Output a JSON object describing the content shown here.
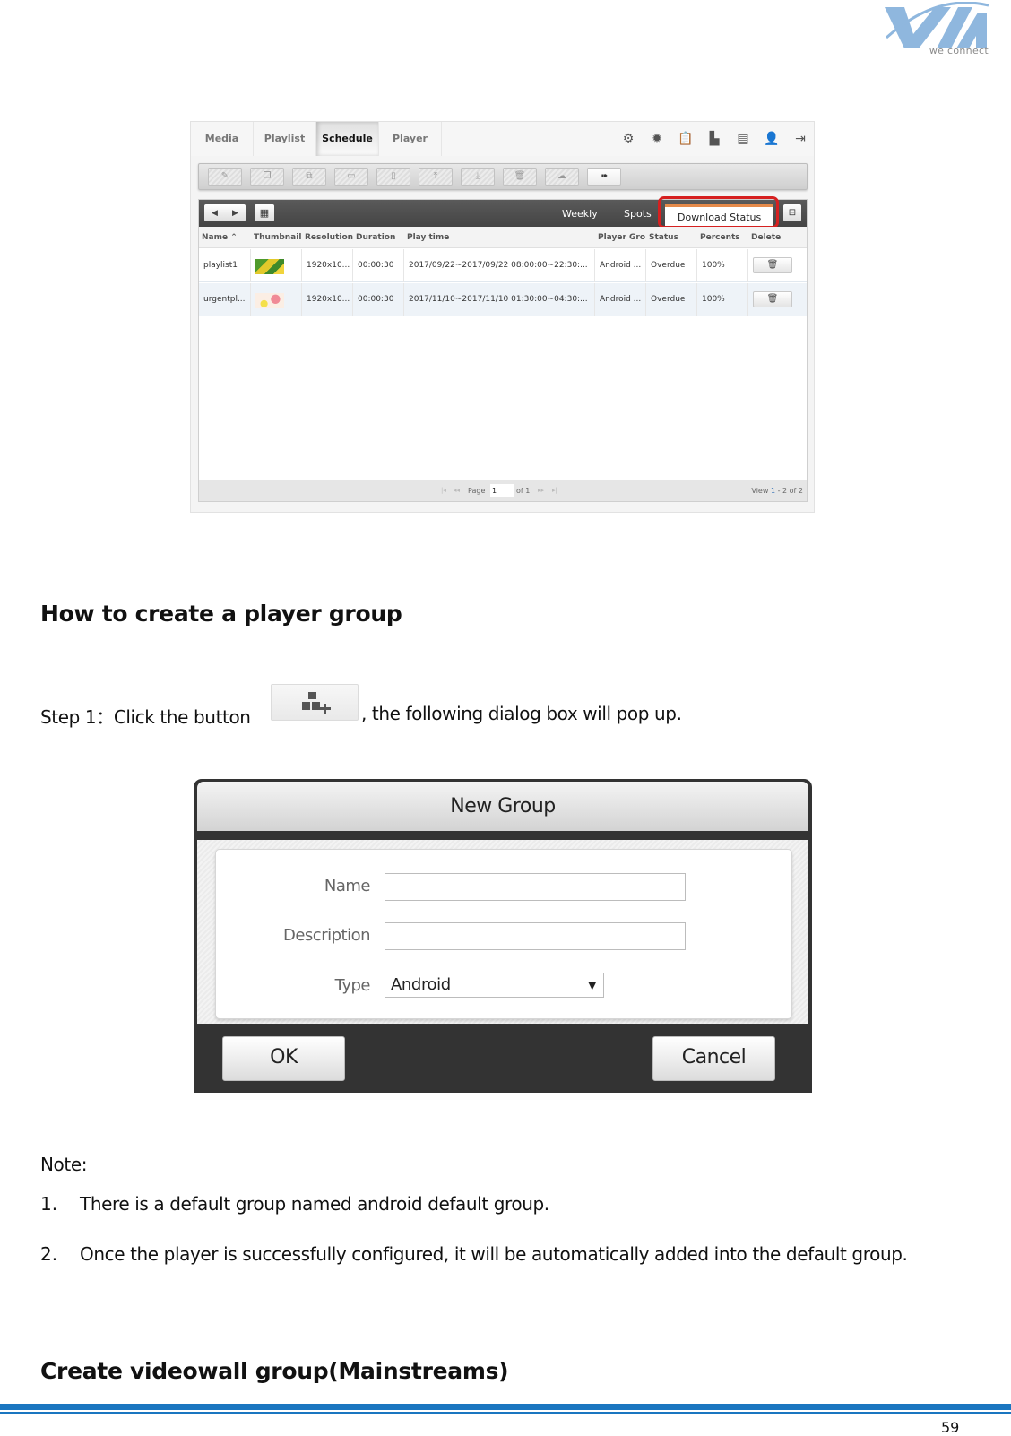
{
  "logo": {
    "text": "we connect",
    "color": "#8fb7de"
  },
  "schedule_ui": {
    "nav_tabs": [
      {
        "label": "Media",
        "active": false
      },
      {
        "label": "Playlist",
        "active": false
      },
      {
        "label": "Schedule",
        "active": true
      },
      {
        "label": "Player",
        "active": false
      }
    ],
    "header_icons": [
      "settings-gears-icon",
      "gear-icon",
      "clipboard-icon",
      "bar-chart-icon",
      "panel-icon",
      "user-icon",
      "logout-icon"
    ],
    "toolbar_buttons": [
      {
        "icon": "edit-icon",
        "glyph": "✎",
        "enabled": false
      },
      {
        "icon": "copy-icon",
        "glyph": "❐",
        "enabled": false
      },
      {
        "icon": "duplicate-icon",
        "glyph": "⧉",
        "enabled": false
      },
      {
        "icon": "align-icon",
        "glyph": "▭",
        "enabled": false
      },
      {
        "icon": "column-icon",
        "glyph": "▯",
        "enabled": false
      },
      {
        "icon": "move-top-icon",
        "glyph": "⤒",
        "enabled": false
      },
      {
        "icon": "move-bottom-icon",
        "glyph": "⤓",
        "enabled": false
      },
      {
        "icon": "trash-icon",
        "glyph": "🗑",
        "enabled": false
      },
      {
        "icon": "cloud-upload-icon",
        "glyph": "☁",
        "enabled": false
      },
      {
        "icon": "forward-icon",
        "glyph": "➠",
        "enabled": true
      }
    ],
    "view_tabs": [
      {
        "label": "Weekly",
        "active": false
      },
      {
        "label": "Spots",
        "active": false
      },
      {
        "label": "Download Status",
        "active": true
      }
    ],
    "highlight_color": "#d62020",
    "columns": [
      "Name ⌃",
      "Thumbnail",
      "Resolution",
      "Duration",
      "Play time",
      "Player Gro",
      "Status",
      "Percents",
      "Delete"
    ],
    "rows": [
      {
        "name": "playlist1",
        "resolution": "1920x10...",
        "duration": "00:00:30",
        "play_time": "2017/09/22~2017/09/22 08:00:00~22:30:...",
        "player_group": "Android ...",
        "status": "Overdue",
        "percents": "100%"
      },
      {
        "name": "urgentpl...",
        "resolution": "1920x10...",
        "duration": "00:00:30",
        "play_time": "2017/11/10~2017/11/10 01:30:00~04:30:...",
        "player_group": "Android ...",
        "status": "Overdue",
        "percents": "100%"
      }
    ],
    "pager": {
      "page_label": "Page",
      "page_value": "1",
      "of_label": "of 1",
      "view_prefix": "View",
      "view_from": "1",
      "view_sep": "-",
      "view_to": "2 of 2"
    }
  },
  "doc": {
    "heading1": "How to create a player group",
    "step1_prefix": "Step 1：Click the button",
    "step1_suffix": ", the following dialog box will pop up.",
    "note_label": "Note:",
    "notes": [
      {
        "num": "1.",
        "text": "There is a default group named android default group."
      },
      {
        "num": "2.",
        "text": "Once the player is successfully configured, it will be automatically added into the default group."
      }
    ],
    "heading2": "Create videowall group(Mainstreams)",
    "page_number": "59"
  },
  "dialog": {
    "title": "New Group",
    "fields": {
      "name_label": "Name",
      "name_value": "",
      "description_label": "Description",
      "description_value": "",
      "type_label": "Type",
      "type_value": "Android"
    },
    "ok_label": "OK",
    "cancel_label": "Cancel"
  },
  "footer": {
    "rule_color": "#1a76c0"
  }
}
